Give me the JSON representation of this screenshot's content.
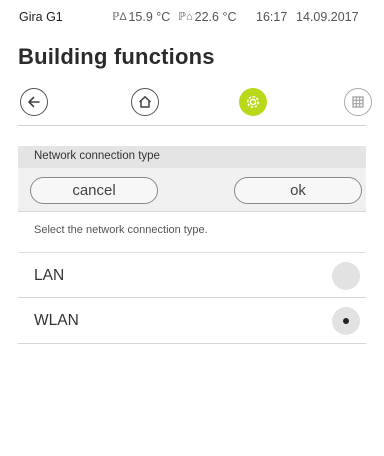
{
  "status": {
    "device": "Gira G1",
    "outdoor_temp": "15.9 °C",
    "indoor_temp": "22.6 °C",
    "time": "16:17",
    "date": "14.09.2017"
  },
  "page": {
    "title": "Building functions"
  },
  "nav": {
    "icons": [
      "back-arrow-icon",
      "home-icon",
      "settings-gear-icon",
      "grid-icon"
    ],
    "active_color": "#b9d81a"
  },
  "dialog": {
    "title": "Network connection type",
    "cancel_label": "cancel",
    "ok_label": "ok",
    "instruction": "Select the network connection type.",
    "options": [
      {
        "label": "LAN",
        "selected": false
      },
      {
        "label": "WLAN",
        "selected": true
      }
    ]
  }
}
